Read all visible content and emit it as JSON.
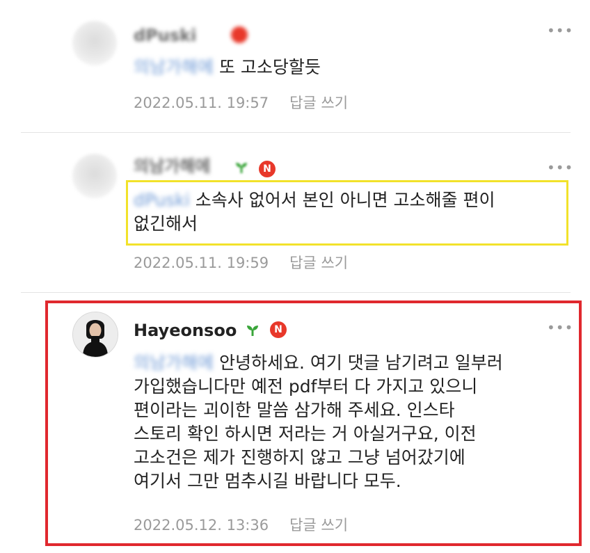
{
  "comments": [
    {
      "author": "dPuski",
      "mention": "의남가해에",
      "text": "또 고소당할듯",
      "timestamp": "2022.05.11. 19:57",
      "reply_label": "답글 쓰기",
      "more_label": "•••"
    },
    {
      "author": "의남가해에",
      "badge": "N",
      "mention": "dPuski",
      "text_lines": [
        "소속사 없어서 본인 아니면 고소해줄 편이",
        "없긴해서"
      ],
      "timestamp": "2022.05.11. 19:59",
      "reply_label": "답글 쓰기",
      "more_label": "•••"
    },
    {
      "author": "Hayeonsoo",
      "badge": "N",
      "mention": "의남가해에",
      "text_lines": [
        "안녕하세요. 여기 댓글 남기려고 일부러",
        "가입했습니다만 예전 pdf부터 다 가지고 있으니",
        "편이라는 괴이한 말씀 삼가해 주세요. 인스타",
        "스토리 확인 하시면 저라는 거 아실거구요, 이전",
        "고소건은 제가 진행하지 않고 그냥 넘어갔기에",
        "여기서 그만 멈추시길 바랍니다 모두."
      ],
      "timestamp": "2022.05.12. 13:36",
      "reply_label": "답글 쓰기",
      "more_label": "•••"
    }
  ],
  "colors": {
    "highlight_yellow": "#f2e22a",
    "highlight_red": "#e0282e",
    "badge_red": "#e8382a",
    "sprout_green": "#3aa53a",
    "mention_blue": "#6f9ad6",
    "meta_gray": "#9a9a9a"
  }
}
